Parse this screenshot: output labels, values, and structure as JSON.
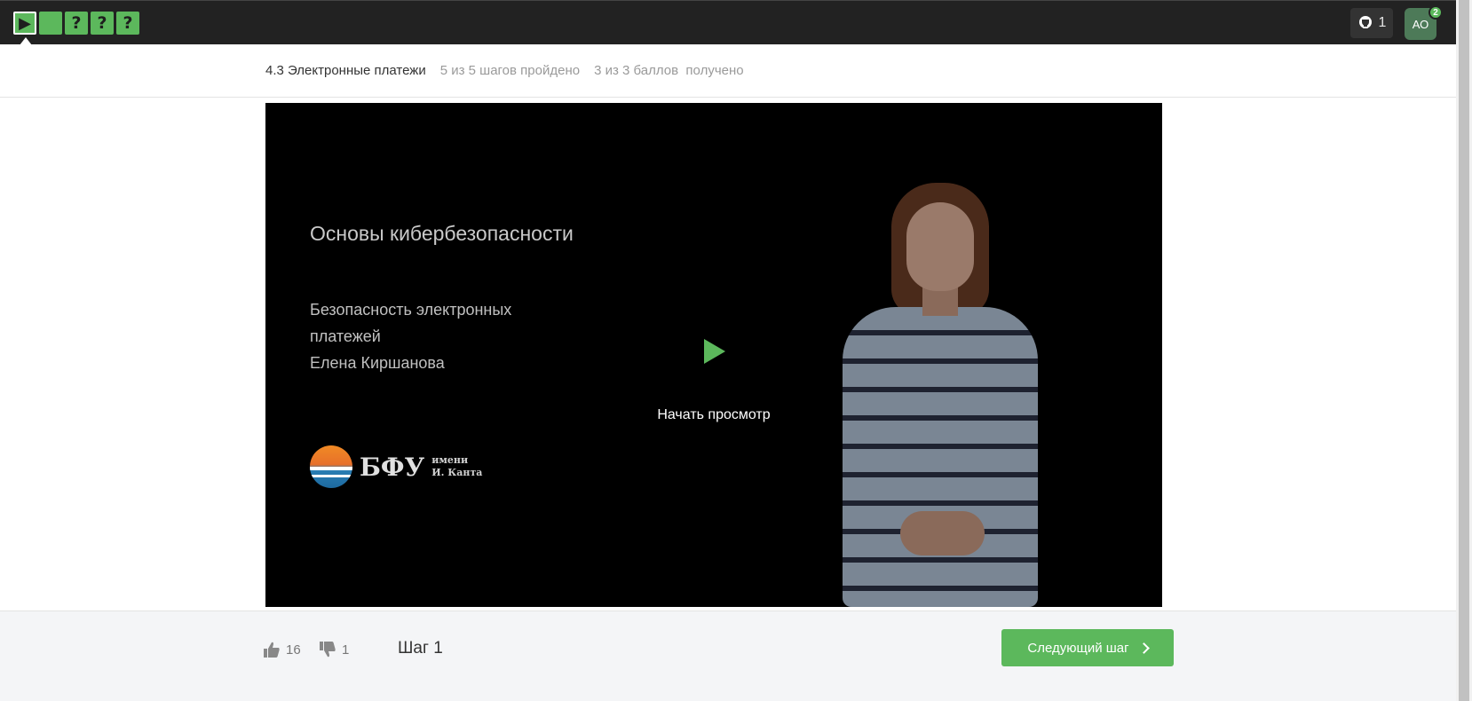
{
  "topbar": {
    "steps": [
      {
        "kind": "video",
        "glyph": "▶",
        "active": true
      },
      {
        "kind": "text",
        "glyph": ""
      },
      {
        "kind": "quiz",
        "glyph": "?"
      },
      {
        "kind": "quiz",
        "glyph": "?"
      },
      {
        "kind": "quiz",
        "glyph": "?"
      }
    ],
    "reward_count": "1",
    "reward_icon": "trophy-icon",
    "avatar_initials": "АО",
    "notification_count": "2"
  },
  "lesson": {
    "title": "4.3 Электронные платежи",
    "steps_progress": "5 из 5 шагов пройдено",
    "score_progress": "3 из 3 баллов  получено"
  },
  "video": {
    "slide_title": "Основы кибербезопасности",
    "slide_subtitle_line1": "Безопасность электронных платежей",
    "slide_author": "Елена Киршанова",
    "logo_text": "БФУ",
    "logo_name_line1": "имени",
    "logo_name_line2": "И. Канта",
    "play_label": "Начать просмотр"
  },
  "footer": {
    "likes": "16",
    "dislikes": "1",
    "step_label": "Шаг 1",
    "next_button": "Следующий шаг"
  },
  "colors": {
    "accent": "#5cb85c",
    "topbar": "#222222",
    "avatar": "#4d7a58"
  }
}
